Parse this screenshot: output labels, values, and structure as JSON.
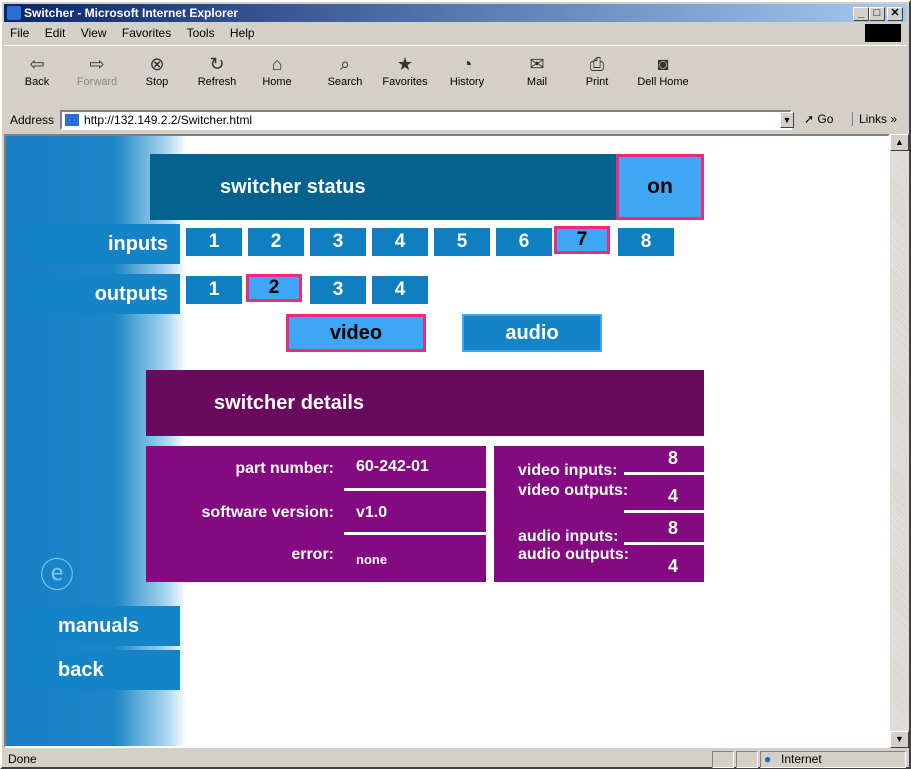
{
  "window": {
    "title": "Switcher - Microsoft Internet Explorer",
    "controls": {
      "minimize": "_",
      "maximize": "□",
      "close": "✕"
    }
  },
  "menu": [
    "File",
    "Edit",
    "View",
    "Favorites",
    "Tools",
    "Help"
  ],
  "toolbar": [
    {
      "label": "Back",
      "icon": "back-arrow-icon",
      "glyph": "⇦"
    },
    {
      "label": "Forward",
      "icon": "forward-arrow-icon",
      "glyph": "⇨"
    },
    {
      "label": "Stop",
      "icon": "stop-icon",
      "glyph": "⊗"
    },
    {
      "label": "Refresh",
      "icon": "refresh-icon",
      "glyph": "↻"
    },
    {
      "label": "Home",
      "icon": "home-icon",
      "glyph": "⌂"
    },
    {
      "label": "Search",
      "icon": "search-icon",
      "glyph": "⌕"
    },
    {
      "label": "Favorites",
      "icon": "favorites-icon",
      "glyph": "★"
    },
    {
      "label": "History",
      "icon": "history-icon",
      "glyph": "◔"
    },
    {
      "label": "Mail",
      "icon": "mail-icon",
      "glyph": "✉"
    },
    {
      "label": "Print",
      "icon": "print-icon",
      "glyph": "⎙"
    },
    {
      "label": "Dell Home",
      "icon": "dell-home-icon",
      "glyph": "◙"
    }
  ],
  "address": {
    "label": "Address",
    "url": "http://132.149.2.2/Switcher.html",
    "go_label": "Go",
    "links_label": "Links »"
  },
  "status_bar": {
    "text": "Done",
    "zone": "Internet"
  },
  "page": {
    "switcher_status_label": "switcher status",
    "power_state": "on",
    "inputs_label": "inputs",
    "inputs": [
      "1",
      "2",
      "3",
      "4",
      "5",
      "6",
      "7",
      "8"
    ],
    "selected_input": "7",
    "outputs_label": "outputs",
    "outputs": [
      "1",
      "2",
      "3",
      "4"
    ],
    "selected_output": "2",
    "video_label": "video",
    "audio_label": "audio",
    "details_title": "switcher details",
    "part_number_label": "part number:",
    "part_number": "60-242-01",
    "software_version_label": "software version:",
    "software_version": "v1.0",
    "error_label": "error:",
    "error": "none",
    "video_inputs_label": "video inputs:",
    "video_inputs": "8",
    "video_outputs_label": "video outputs:",
    "video_outputs": "4",
    "audio_inputs_label": "audio inputs:",
    "audio_inputs": "8",
    "audio_outputs_label": "audio outputs:",
    "audio_outputs": "4",
    "manuals_label": "manuals",
    "back_label": "back"
  },
  "colors": {
    "nav_blue": "#1584c6",
    "active_blue": "#3da6f5",
    "highlight_pink": "#ee2a7b",
    "status_blue": "#05628f",
    "details_header": "#6a0a5e",
    "details_panel": "#830a80"
  }
}
